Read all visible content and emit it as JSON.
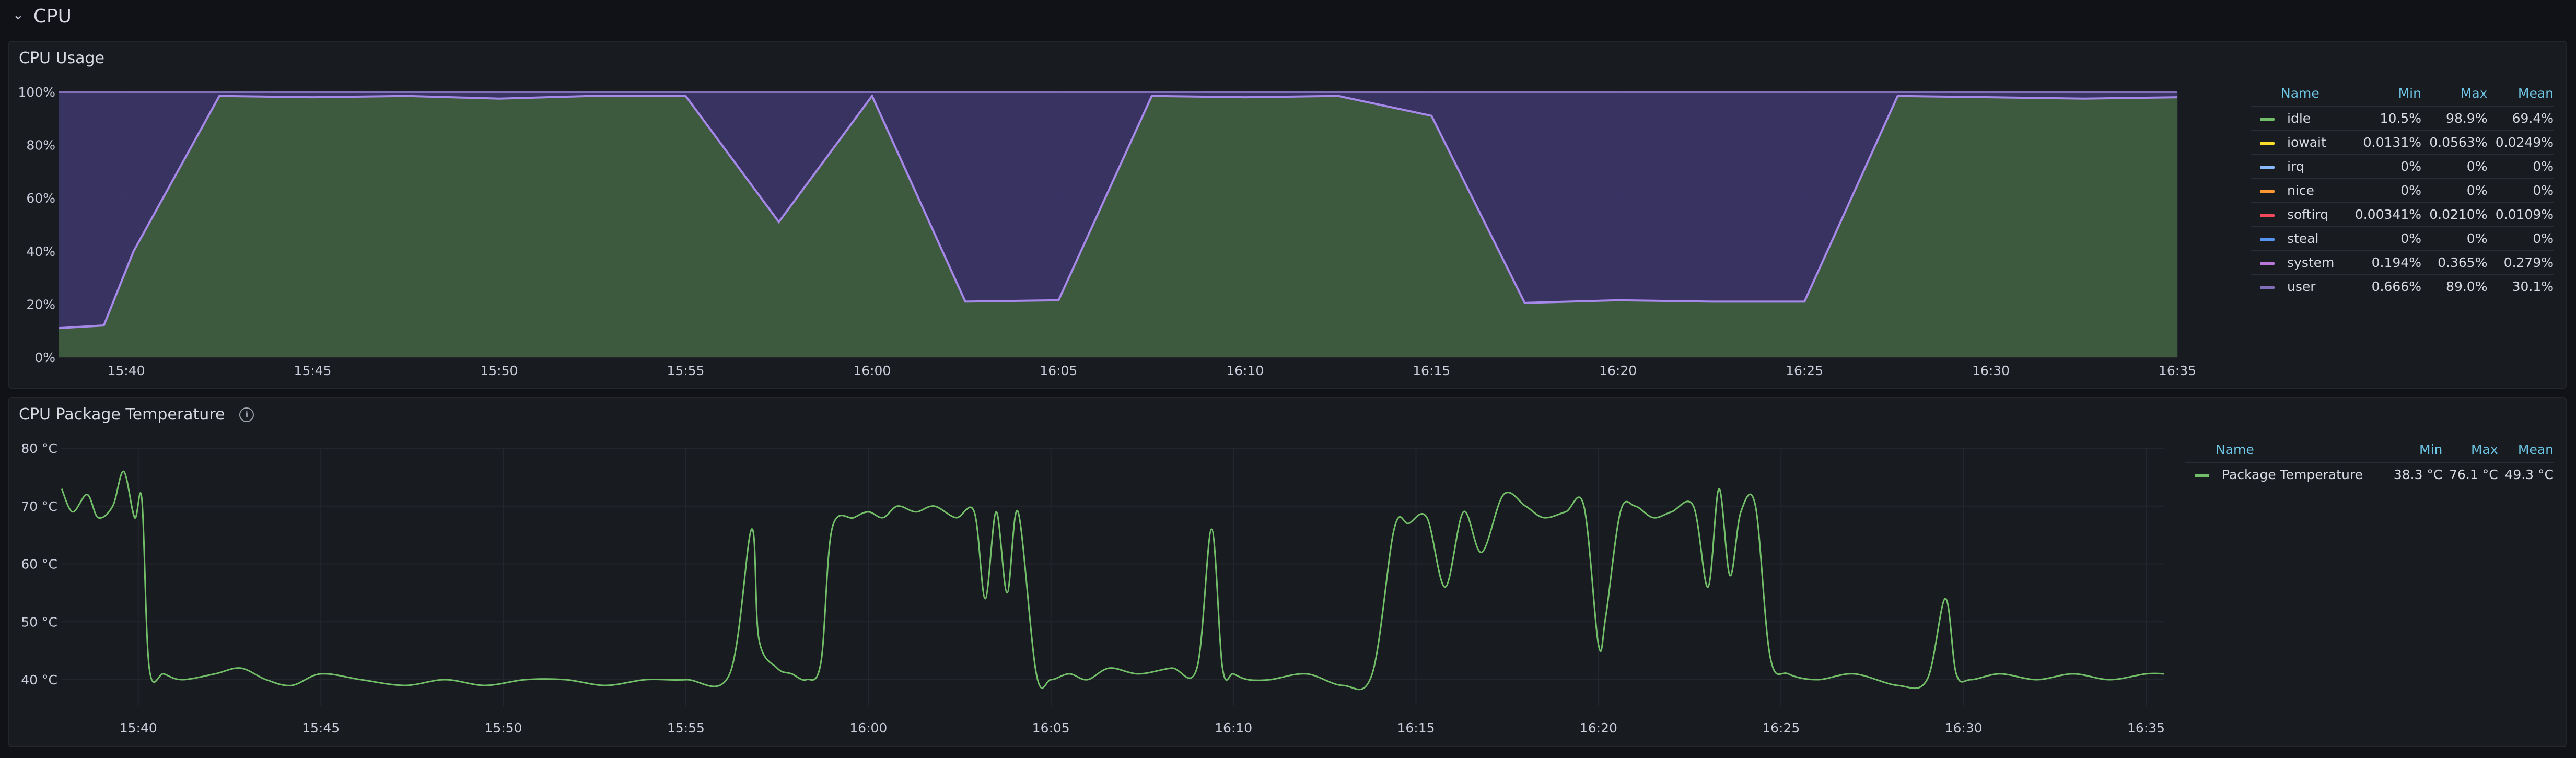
{
  "row": {
    "title": "CPU"
  },
  "panels": [
    {
      "title": "CPU Usage",
      "y_ticks": [
        "100%",
        "80%",
        "60%",
        "40%",
        "20%",
        "0%"
      ],
      "x_ticks": [
        "15:40",
        "15:45",
        "15:50",
        "15:55",
        "16:00",
        "16:05",
        "16:10",
        "16:15",
        "16:20",
        "16:25",
        "16:30",
        "16:35"
      ],
      "legend": {
        "headers": {
          "name": "Name",
          "min": "Min",
          "max": "Max",
          "mean": "Mean"
        },
        "rows": [
          {
            "name": "idle",
            "color": "#73bf69",
            "min": "10.5%",
            "max": "98.9%",
            "mean": "69.4%"
          },
          {
            "name": "iowait",
            "color": "#fade2a",
            "min": "0.0131%",
            "max": "0.0563%",
            "mean": "0.0249%"
          },
          {
            "name": "irq",
            "color": "#8ab8ff",
            "min": "0%",
            "max": "0%",
            "mean": "0%"
          },
          {
            "name": "nice",
            "color": "#ff9830",
            "min": "0%",
            "max": "0%",
            "mean": "0%"
          },
          {
            "name": "softirq",
            "color": "#f2495c",
            "min": "0.00341%",
            "max": "0.0210%",
            "mean": "0.0109%"
          },
          {
            "name": "steal",
            "color": "#5794f2",
            "min": "0%",
            "max": "0%",
            "mean": "0%"
          },
          {
            "name": "system",
            "color": "#b877d9",
            "min": "0.194%",
            "max": "0.365%",
            "mean": "0.279%"
          },
          {
            "name": "user",
            "color": "#806eb7",
            "min": "0.666%",
            "max": "89.0%",
            "mean": "30.1%"
          }
        ]
      }
    },
    {
      "title": "CPU Package Temperature",
      "y_ticks": [
        "80 °C",
        "70 °C",
        "60 °C",
        "50 °C",
        "40 °C"
      ],
      "x_ticks": [
        "15:40",
        "15:45",
        "15:50",
        "15:55",
        "16:00",
        "16:05",
        "16:10",
        "16:15",
        "16:20",
        "16:25",
        "16:30",
        "16:35"
      ],
      "legend": {
        "headers": {
          "name": "Name",
          "min": "Min",
          "max": "Max",
          "mean": "Mean"
        },
        "rows": [
          {
            "name": "Package Temperature",
            "color": "#73bf69",
            "min": "38.3 °C",
            "max": "76.1 °C",
            "mean": "49.3 °C"
          }
        ]
      }
    }
  ],
  "chart_data": [
    {
      "type": "area",
      "title": "CPU Usage",
      "ylim": [
        0,
        100
      ],
      "x_unit": "minutes",
      "x": [
        38.2,
        39.4,
        40.2,
        42.5,
        45.0,
        47.5,
        50.0,
        52.5,
        55.0,
        57.5,
        60.0,
        62.5,
        65.0,
        67.5,
        70.0,
        72.5,
        75.0,
        77.5,
        80.0,
        82.5,
        85.0,
        87.5,
        90.0,
        92.5,
        95.0
      ],
      "series": [
        {
          "name": "idle",
          "values": [
            11,
            12,
            40,
            98.5,
            98,
            98.5,
            97.5,
            98.5,
            98.5,
            51,
            98.5,
            21,
            21.5,
            98.5,
            98,
            98.5,
            91,
            20.5,
            21.5,
            21,
            21,
            98.5,
            98,
            97.5,
            98
          ]
        },
        {
          "name": "user",
          "values": [
            88.7,
            87.7,
            59.7,
            1.2,
            1.7,
            1.2,
            2.2,
            1.2,
            1.2,
            48.7,
            1.2,
            78.7,
            78.2,
            1.2,
            1.7,
            1.2,
            8.7,
            79.2,
            78.2,
            78.7,
            78.7,
            1.2,
            1.7,
            2.2,
            1.7
          ]
        }
      ]
    },
    {
      "type": "line",
      "title": "CPU Package Temperature",
      "ylim": [
        37,
        80
      ],
      "x_unit": "minutes",
      "x": [
        37.9,
        38.2,
        38.6,
        38.9,
        39.3,
        39.6,
        39.9,
        40.1,
        40.3,
        40.7,
        41.2,
        42.1,
        42.8,
        43.5,
        44.2,
        45.0,
        46.1,
        47.3,
        48.4,
        49.5,
        50.6,
        51.7,
        52.8,
        53.9,
        55.0,
        56.2,
        56.8,
        57.0,
        57.5,
        57.9,
        58.3,
        58.7,
        59.0,
        59.6,
        60.0,
        60.4,
        60.8,
        61.3,
        61.8,
        62.4,
        62.9,
        63.2,
        63.5,
        63.8,
        64.1,
        64.6,
        65.0,
        65.5,
        66.0,
        66.6,
        67.4,
        68.3,
        69.0,
        69.4,
        69.7,
        70.0,
        70.4,
        71.0,
        72.0,
        73.0,
        73.8,
        74.4,
        74.8,
        75.3,
        75.8,
        76.3,
        76.8,
        77.4,
        78.0,
        78.5,
        79.1,
        79.6,
        80.0,
        80.2,
        80.6,
        81.0,
        81.5,
        82.0,
        82.6,
        83.0,
        83.3,
        83.6,
        83.9,
        84.3,
        84.7,
        85.2,
        86.0,
        87.0,
        88.2,
        89.0,
        89.5,
        89.8,
        90.2,
        91.0,
        92.0,
        93.0,
        94.0,
        95.0,
        95.5
      ],
      "series": [
        {
          "name": "Package Temperature",
          "values": [
            73,
            69,
            72,
            68,
            70,
            76,
            68,
            71,
            42,
            41,
            40,
            41,
            42,
            40,
            39,
            41,
            40,
            39,
            40,
            39,
            40,
            40,
            39,
            40,
            40,
            41,
            66,
            47,
            42,
            41,
            40,
            43,
            66,
            68,
            69,
            68,
            70,
            69,
            70,
            68,
            69,
            54,
            69,
            55,
            69,
            41,
            40,
            41,
            40,
            42,
            41,
            42,
            42,
            66,
            42,
            41,
            40,
            40,
            41,
            39,
            41,
            66,
            67,
            68,
            56,
            69,
            62,
            72,
            70,
            68,
            69,
            70,
            46,
            51,
            69,
            70,
            68,
            69,
            70,
            56,
            73,
            58,
            69,
            70,
            44,
            41,
            40,
            41,
            39,
            40,
            54,
            41,
            40,
            41,
            40,
            41,
            40,
            41,
            41
          ]
        }
      ]
    }
  ]
}
